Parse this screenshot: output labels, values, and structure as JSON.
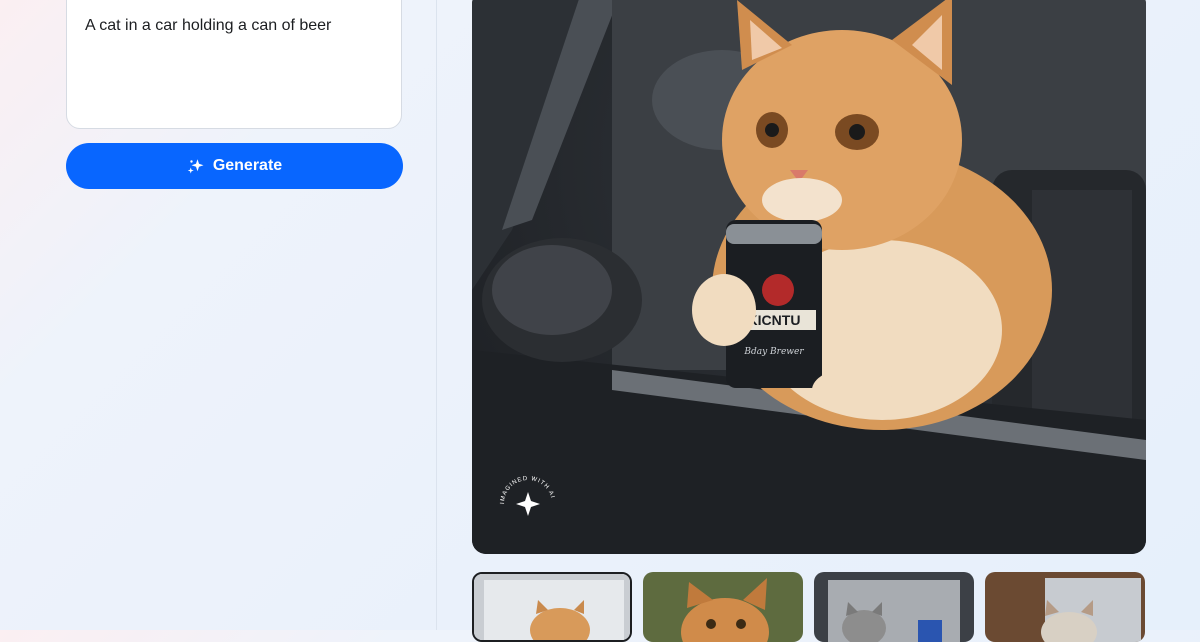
{
  "prompt": {
    "value": "A cat in a car holding a can of beer"
  },
  "generate_button": {
    "label": "Generate",
    "icon": "sparkle-icon"
  },
  "main_image": {
    "watermark_text": "IMAGINED WITH AI",
    "can_label": "KICNTU",
    "can_script": "Bday Brewer"
  },
  "thumbnails": {
    "selected_index": 0,
    "count": 4
  },
  "colors": {
    "accent": "#0866ff",
    "text": "#1c1e21",
    "border": "#d6dbe3"
  }
}
